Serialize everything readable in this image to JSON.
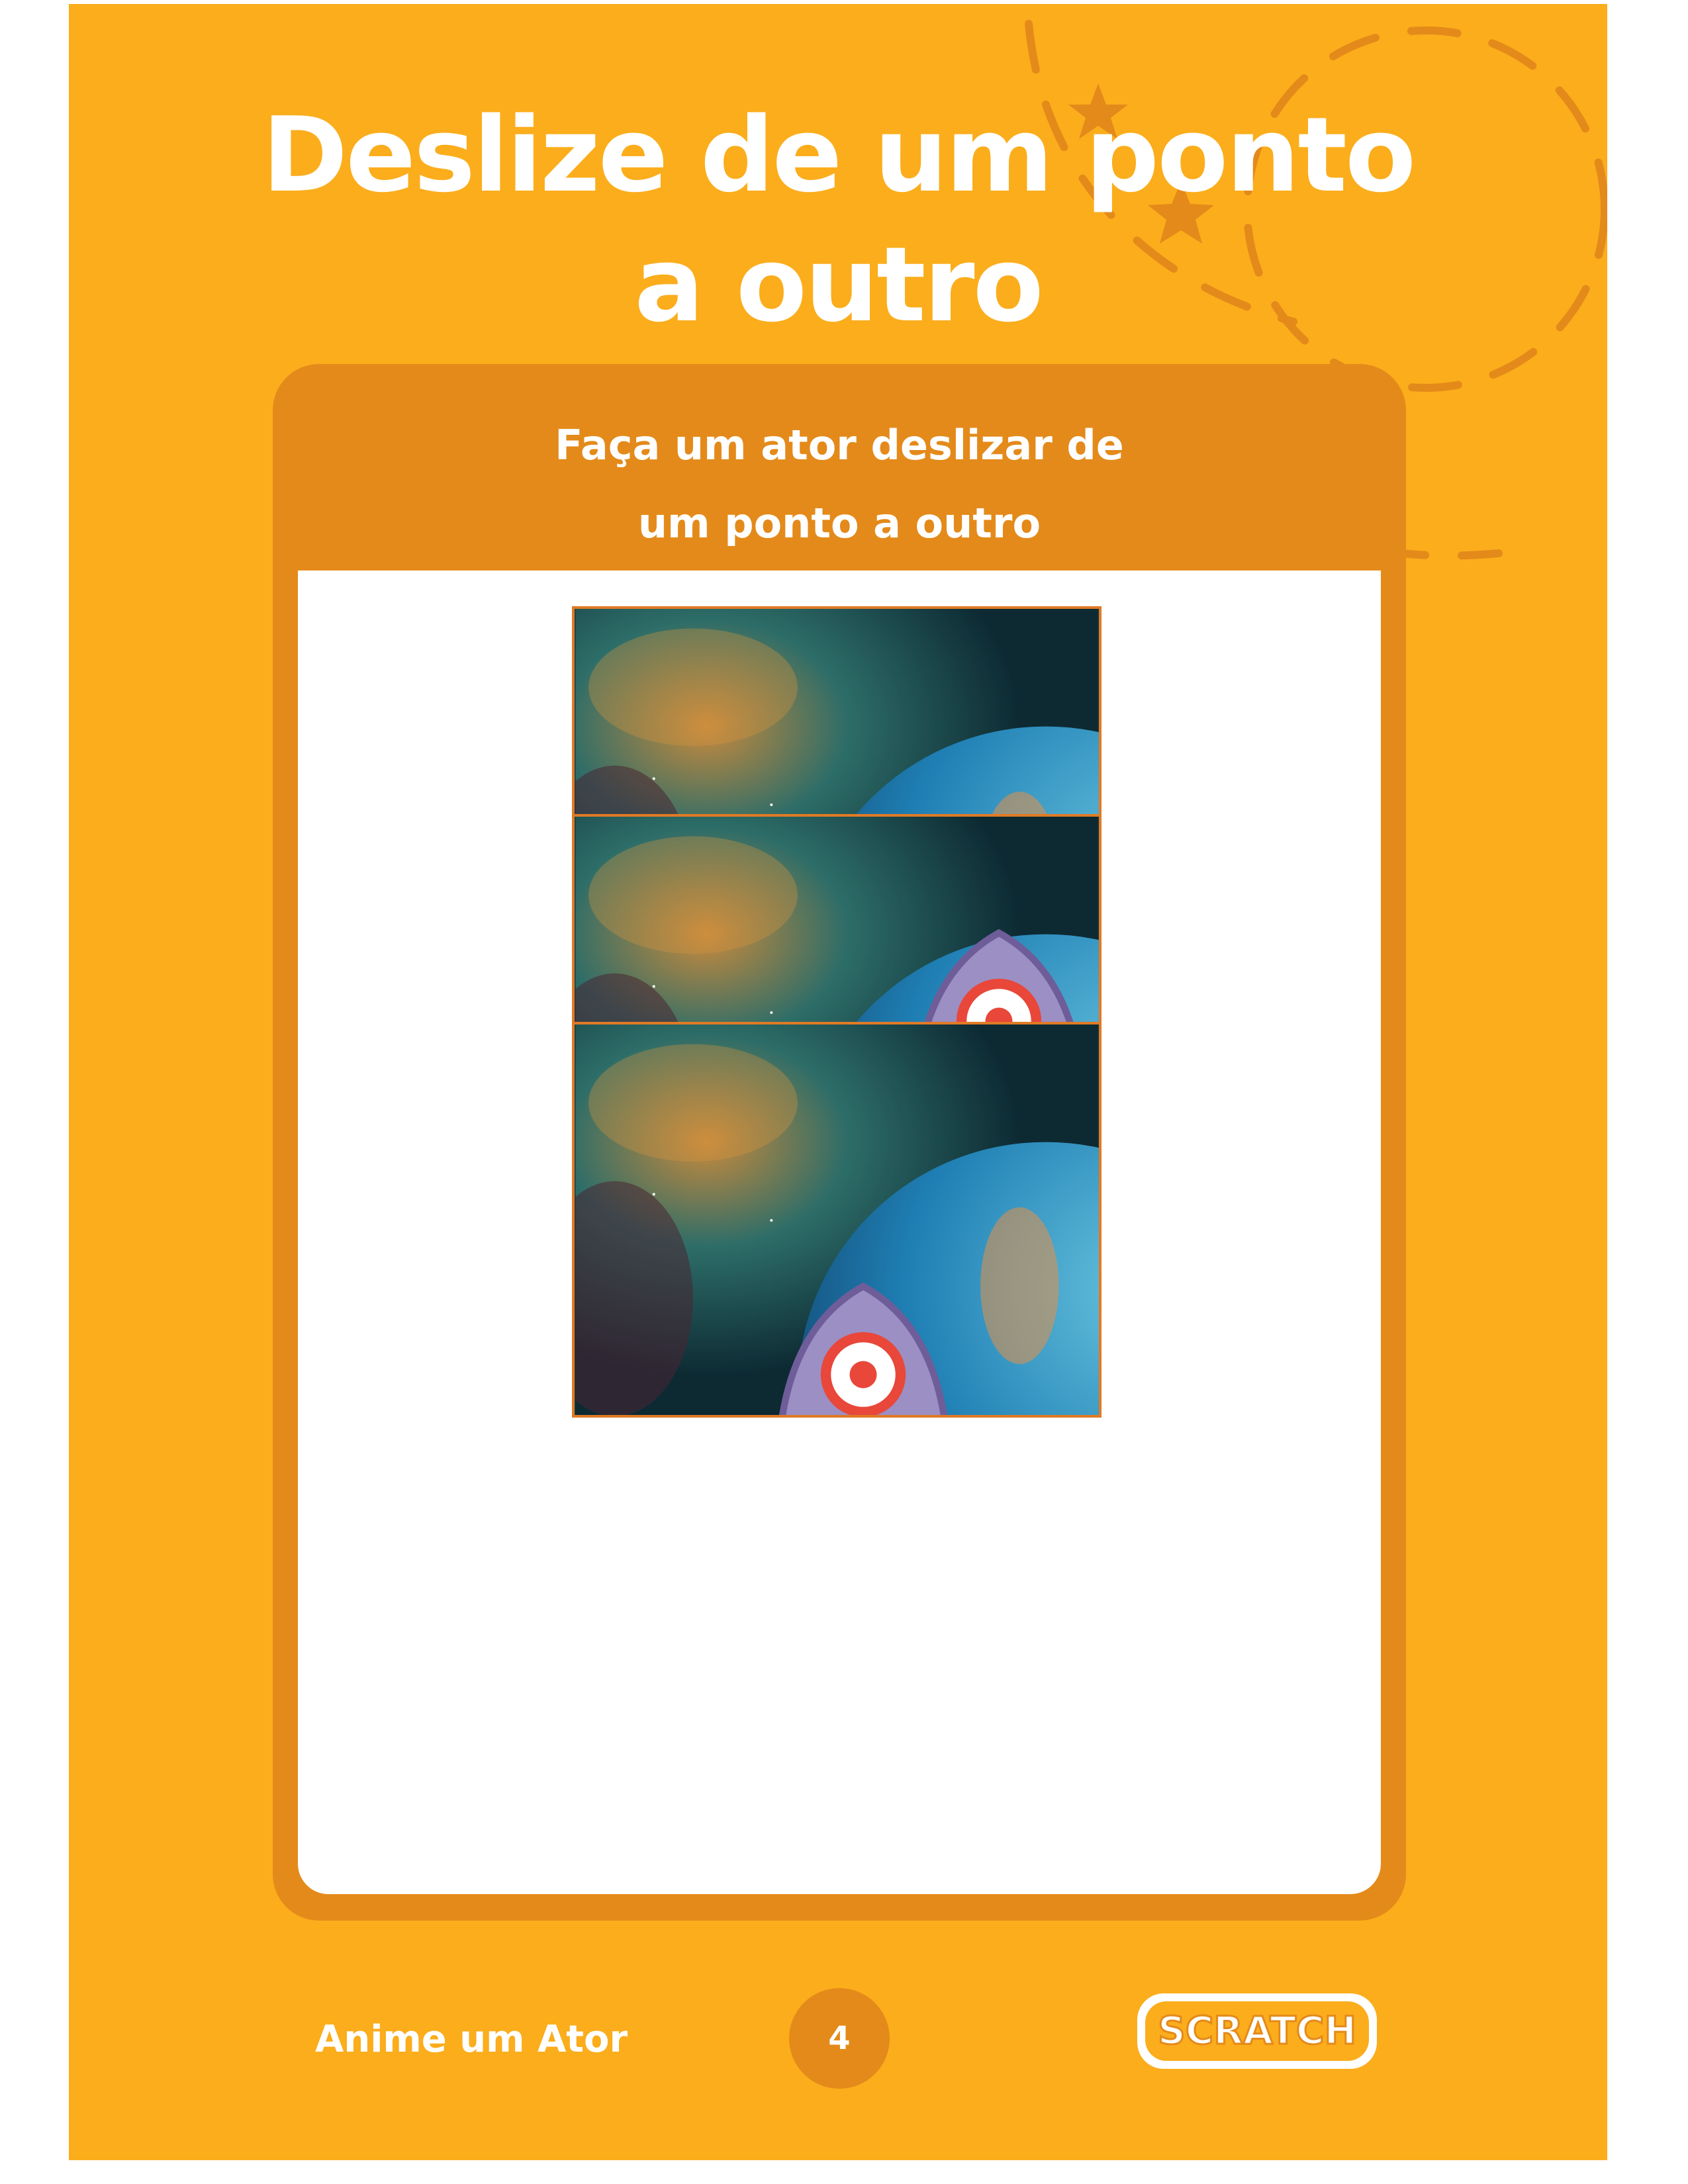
{
  "page": {
    "title_line1": "Deslize de um ponto",
    "title_line2": "a outro",
    "background_color": "#FBAD1C"
  },
  "card": {
    "header_line1": "Faça um ator deslizar de",
    "header_line2": "um ponto a outro",
    "color": "#E48A1A",
    "frames": [
      {
        "name": "rocket-top-right",
        "sprite": "rocket-icon"
      },
      {
        "name": "rocket-middle-left",
        "sprite": "rocket-icon"
      },
      {
        "name": "rocket-bottom-left",
        "sprite": "rocket-icon"
      }
    ]
  },
  "footer": {
    "label": "Anime um Ator",
    "page_number": "4",
    "logo_text": "SCRATCH"
  }
}
